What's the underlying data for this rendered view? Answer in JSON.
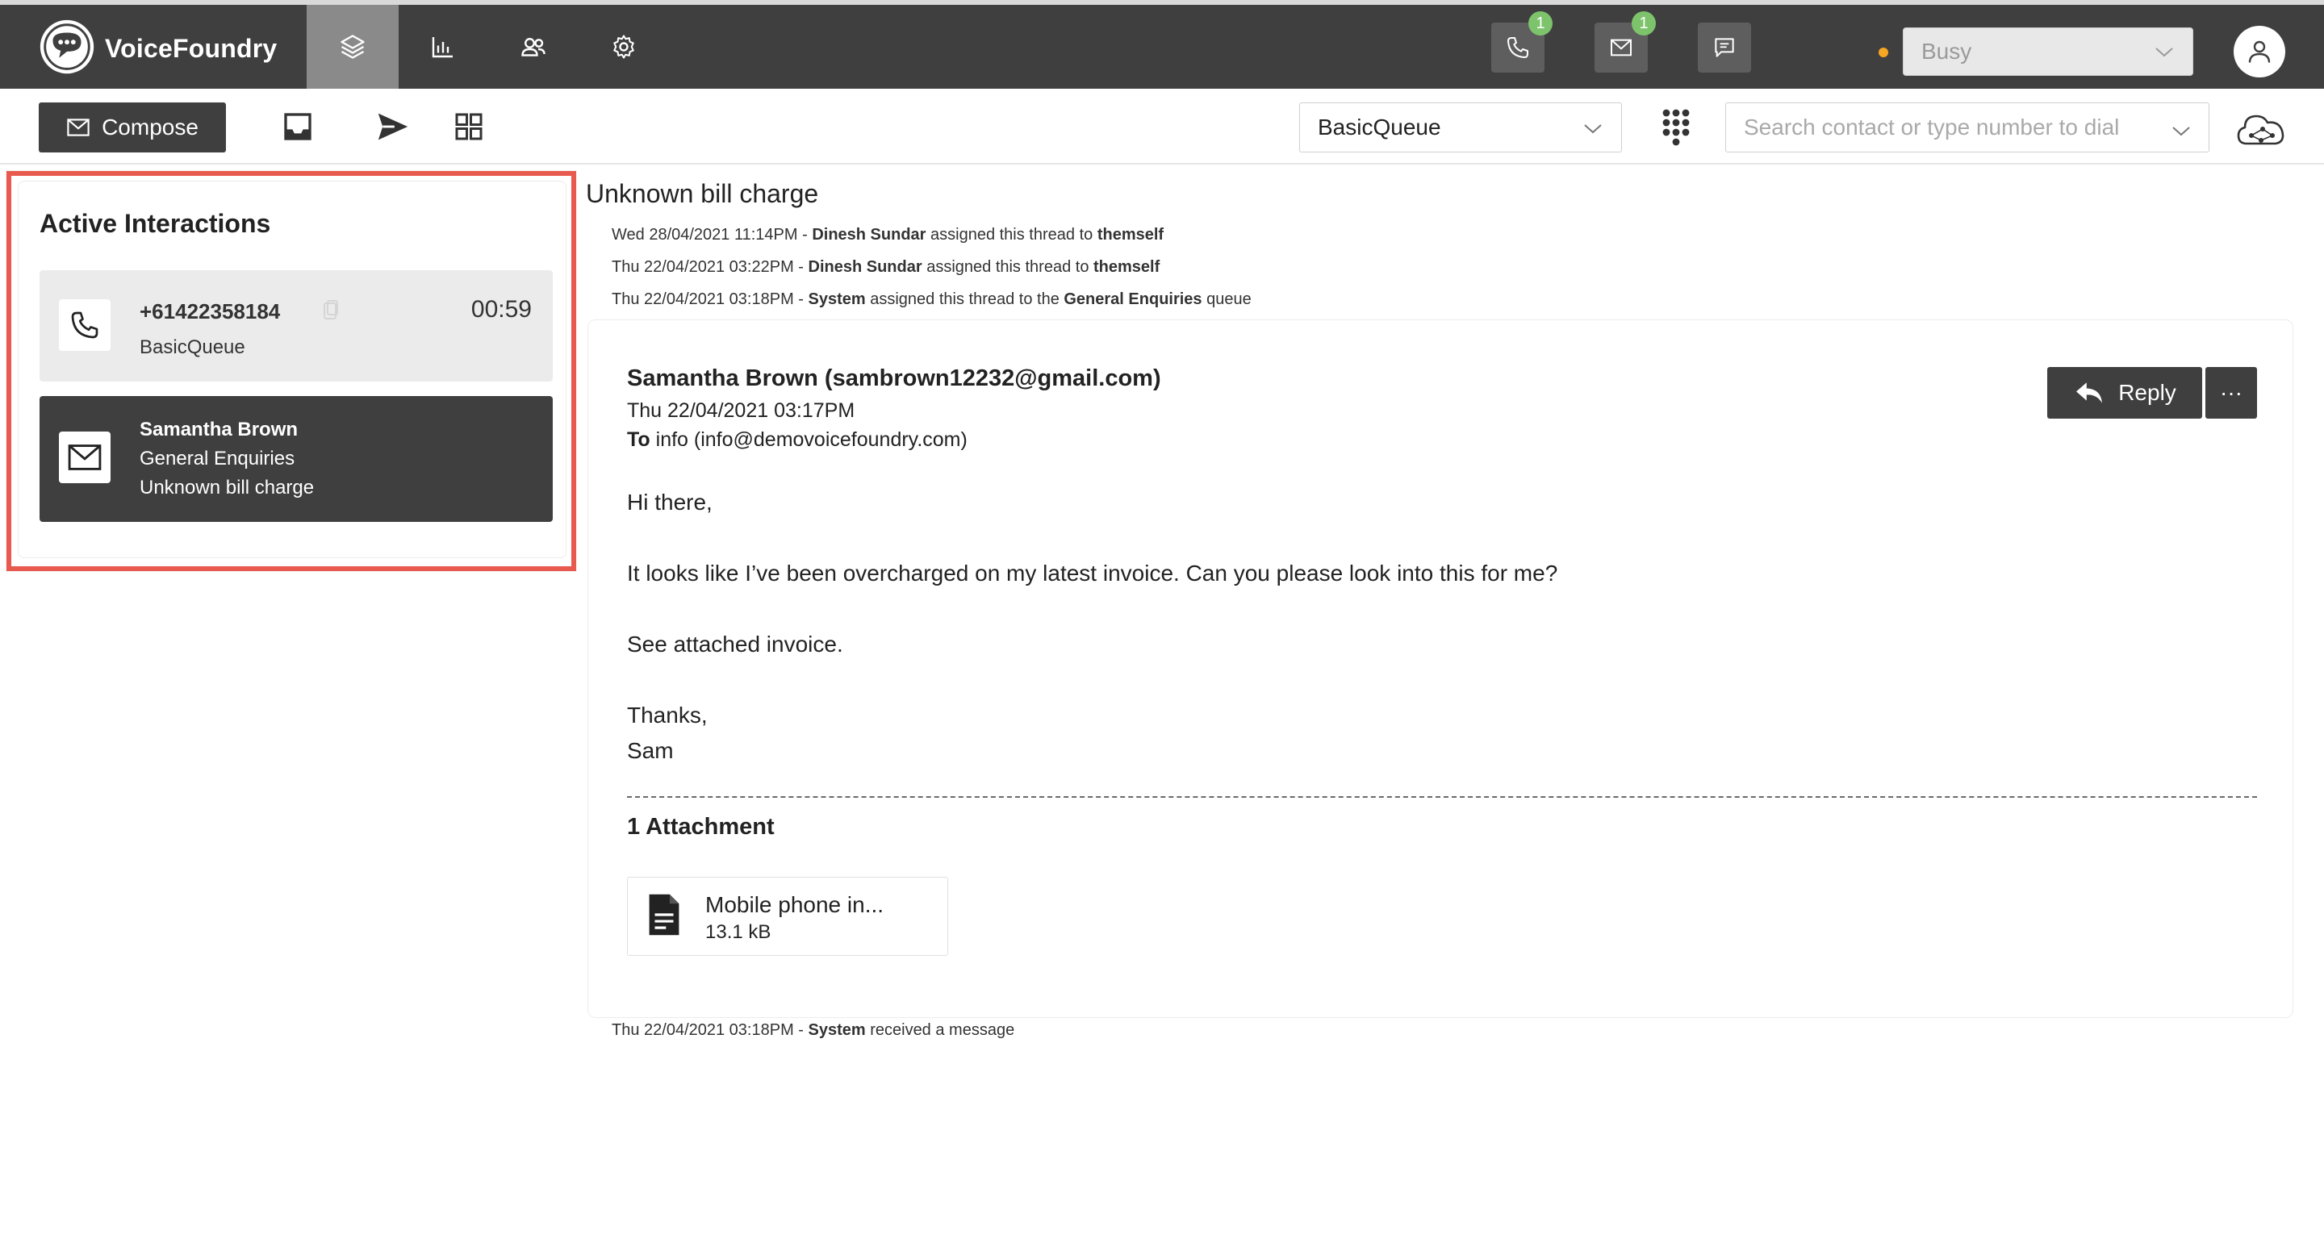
{
  "app": {
    "name": "VoiceFoundry",
    "nav": [
      "layers-icon",
      "chart-icon",
      "people-icon",
      "gear-icon"
    ],
    "header_buttons": [
      {
        "icon": "phone-icon",
        "badge": "1"
      },
      {
        "icon": "mail-icon",
        "badge": "1"
      },
      {
        "icon": "chat-icon",
        "badge": ""
      }
    ],
    "status": {
      "value": "Busy",
      "dot_color": "#f5a623"
    }
  },
  "toolbar": {
    "compose_label": "Compose",
    "icons": [
      "inbox-icon",
      "send-icon",
      "grid-icon"
    ],
    "queue": "BasicQueue",
    "search_placeholder": "Search contact or type number to dial"
  },
  "active_interactions": {
    "title": "Active Interactions",
    "call": {
      "number": "+61422358184",
      "queue": "BasicQueue",
      "timer": "00:59"
    },
    "email": {
      "name": "Samantha Brown",
      "queue": "General Enquiries",
      "subject": "Unknown bill charge"
    }
  },
  "thread": {
    "title": "Unknown bill charge",
    "log": [
      {
        "time": "Wed 28/04/2021 11:14PM - ",
        "actor": "Dinesh Sundar",
        "action": " assigned this thread to ",
        "target": "themself",
        "suffix": ""
      },
      {
        "time": "Thu 22/04/2021 03:22PM - ",
        "actor": "Dinesh Sundar",
        "action": " assigned this thread to ",
        "target": "themself",
        "suffix": ""
      },
      {
        "time": "Thu 22/04/2021 03:18PM - ",
        "actor": "System",
        "action": " assigned this thread to the ",
        "target": "General Enquiries",
        "suffix": " queue"
      }
    ],
    "message": {
      "from": "Samantha Brown (sambrown12232@gmail.com)",
      "date": "Thu 22/04/2021 03:17PM",
      "to_label": "To",
      "to_value": " info (info@demovoicefoundry.com)",
      "reply_label": "Reply",
      "more_label": "···",
      "body": {
        "greeting": "Hi there,",
        "p1": "It looks like I’ve been overcharged on my latest invoice. Can you please look into this for me?",
        "p2": "See attached invoice.",
        "signoff": "Thanks,",
        "signature": "Sam"
      },
      "attachments_title": "1 Attachment",
      "attachment": {
        "name": "Mobile phone in...",
        "size": "13.1 kB"
      }
    },
    "footer": {
      "time": "Thu 22/04/2021 03:18PM - ",
      "actor": "System",
      "action": " received a message"
    }
  },
  "colors": {
    "dark": "#3f3f3f",
    "highlight_border": "#e8594e",
    "badge": "#7dc36b"
  }
}
